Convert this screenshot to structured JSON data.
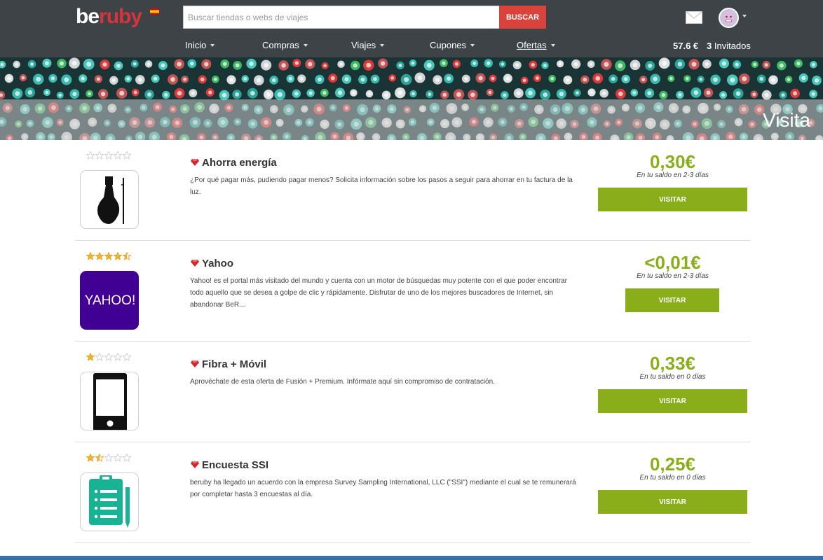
{
  "header": {
    "logo_be": "be",
    "logo_ruby": "ruby",
    "search_placeholder": "Buscar tiendas o webs de viajes",
    "search_button": "BUSCAR",
    "balance": "57.6 €",
    "invited_count": "3",
    "invited_label": "Invitados"
  },
  "nav": [
    {
      "label": "Inicio"
    },
    {
      "label": "Compras"
    },
    {
      "label": "Viajes"
    },
    {
      "label": "Cupones"
    },
    {
      "label": "Ofertas"
    }
  ],
  "banner": {
    "title": "Visita"
  },
  "offers": [
    {
      "title": "Ahorra energía",
      "description": "¿Por qué pagar más, pudiendo pagar menos? Solicita información sobre los pasos a seguir para ahorrar en tu factura de la luz.",
      "price": "0,30€",
      "eta": "En tu saldo en 2-3 días",
      "button": "VISITAR",
      "rating": 0,
      "icon": "lightbulb-icon"
    },
    {
      "title": "Yahoo",
      "description": "Yahoo! es el portal más visitado del mundo y cuenta con un motor de búsquedas muy potente con el que poder encontrar todo aquello que se desea a golpe de clic y rápidamente. Disfrutar de uno de los mejores buscadores de Internet, sin abandonar BeR...",
      "price": "<0,01€",
      "eta": "En tu saldo en 2-3 días",
      "button": "VISITAR",
      "rating": 4.5,
      "icon": "yahoo-logo",
      "logo_text": "YAHOO!"
    },
    {
      "title": "Fibra + Móvil",
      "description": "Aprovéchate de esta oferta de Fusión + Premium. Infórmate aquí sin compromiso de contratación.",
      "price": "0,33€",
      "eta": "En tu saldo en 0 días",
      "button": "VISITAR",
      "rating": 1,
      "icon": "smartphone-icon"
    },
    {
      "title": "Encuesta SSI",
      "description": "beruby ha llegado un acuerdo con la empresa Survey Sampling International, LLC (\"SSI\") mediante el cual se te remunerará por completar hasta 3 encuestas al día.",
      "price": "0,25€",
      "eta": "En tu saldo en 0 días",
      "button": "VISITAR",
      "rating": 1.5,
      "icon": "clipboard-icon"
    }
  ],
  "colors": {
    "header_bg": "#3e4347",
    "accent_green": "#8aae1a",
    "search_red": "#d9433b",
    "logo_red": "#d8333a"
  }
}
